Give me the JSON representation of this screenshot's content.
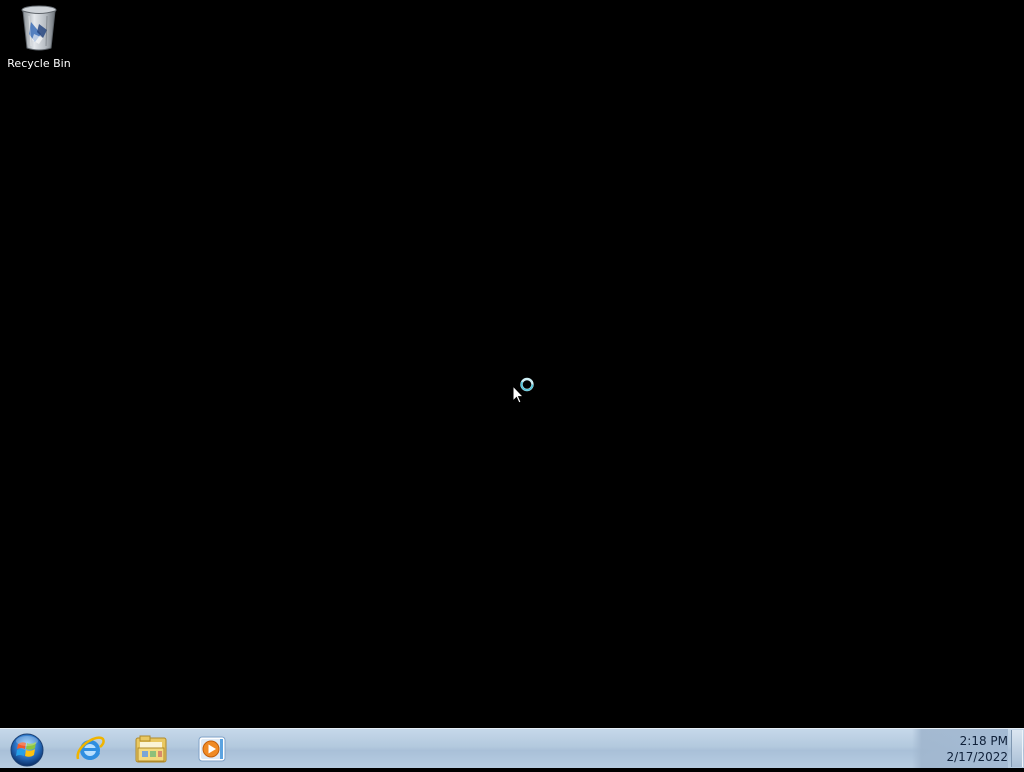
{
  "desktop": {
    "background_color": "#000000",
    "icons": [
      {
        "label": "Recycle Bin",
        "icon": "recycle-bin-icon"
      }
    ]
  },
  "cursor": {
    "state": "working-in-background",
    "icon": "busy-cursor-icon"
  },
  "taskbar": {
    "start_icon": "windows-start-orb-icon",
    "pinned": [
      {
        "app": "Internet Explorer",
        "icon": "internet-explorer-icon"
      },
      {
        "app": "Windows Explorer",
        "icon": "folder-library-icon"
      },
      {
        "app": "Windows Media Player",
        "icon": "media-player-icon"
      }
    ],
    "clock": {
      "time": "2:18 PM",
      "date": "2/17/2022"
    }
  },
  "colors": {
    "taskbar": "#b3c9de",
    "busy_ring": "#4fc3d9"
  }
}
